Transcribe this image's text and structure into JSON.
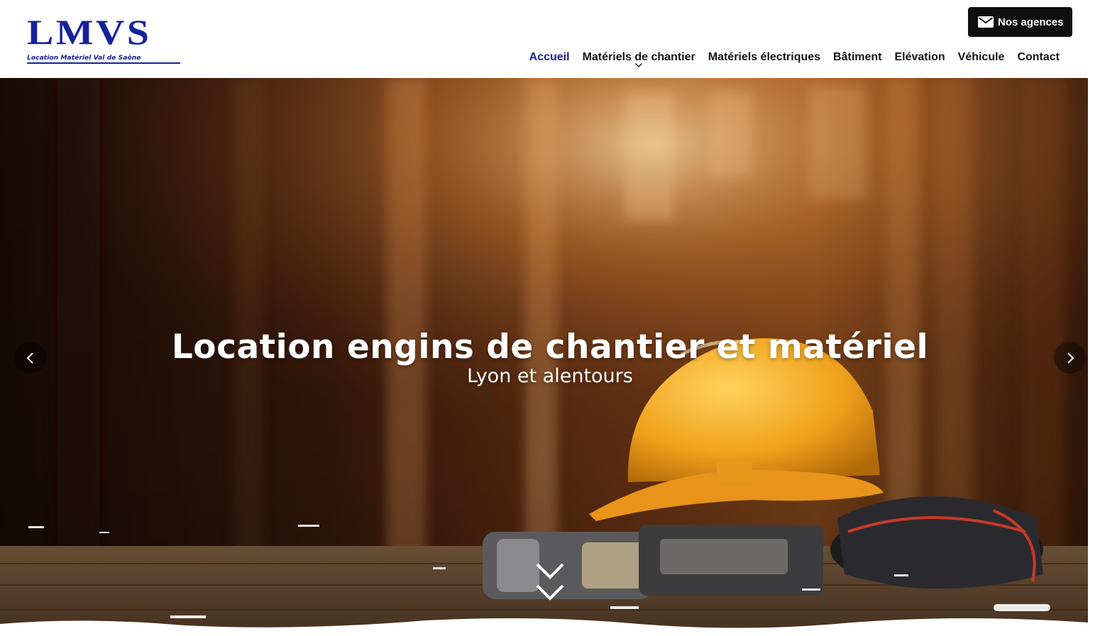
{
  "brand": {
    "logo_text": "LMVS",
    "tagline": "Location Matériel Val de Saône",
    "color": "#16229a"
  },
  "header": {
    "contact_button": {
      "label": "Nos agences",
      "icon": "envelope-icon"
    }
  },
  "nav": {
    "items": [
      {
        "label": "Accueil",
        "active": true
      },
      {
        "label": "Matériels de chantier",
        "has_dropdown": true
      },
      {
        "label": "Matériels électriques"
      },
      {
        "label": "Bâtiment"
      },
      {
        "label": "Elévation"
      },
      {
        "label": "Véhicule"
      },
      {
        "label": "Contact"
      }
    ]
  },
  "hero": {
    "title": "Location engins de chantier et matériel",
    "subtitle": "Lyon et alentours",
    "prev_icon": "chevron-left-icon",
    "next_icon": "chevron-right-icon",
    "scroll_icon": "double-chevron-down-icon"
  },
  "colors": {
    "accent": "#16229a",
    "button_bg": "#0f0f0f",
    "helmet": "#f0a21c"
  }
}
